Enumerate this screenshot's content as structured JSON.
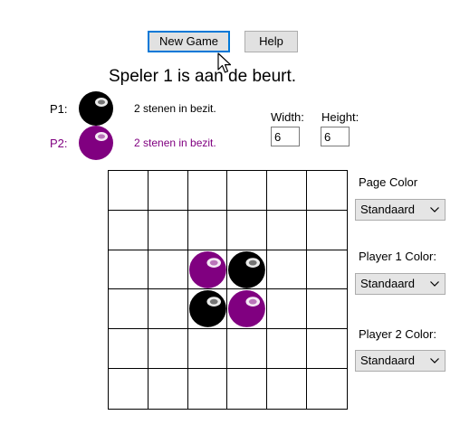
{
  "toolbar": {
    "new_game_label": "New Game",
    "help_label": "Help"
  },
  "status": {
    "turn_text": "Speler 1 is aan de beurt."
  },
  "players": [
    {
      "label": "P1:",
      "stones_text": "2 stenen in bezit.",
      "color": "#000000"
    },
    {
      "label": "P2:",
      "stones_text": "2 stenen in bezit.",
      "color": "#800080"
    }
  ],
  "board_size": {
    "width_label": "Width:",
    "height_label": "Height:",
    "width_value": "6",
    "height_value": "6"
  },
  "board": {
    "rows": 6,
    "cols": 6,
    "cells": [
      [
        "",
        "",
        "",
        "",
        "",
        ""
      ],
      [
        "",
        "",
        "",
        "",
        "",
        ""
      ],
      [
        "",
        "",
        "P2",
        "P1",
        "",
        ""
      ],
      [
        "",
        "",
        "P1",
        "P2",
        "",
        ""
      ],
      [
        "",
        "",
        "",
        "",
        "",
        ""
      ],
      [
        "",
        "",
        "",
        "",
        "",
        ""
      ]
    ]
  },
  "settings": {
    "page_color_label": "Page Color",
    "page_color_value": "Standaard",
    "player1_color_label": "Player 1 Color:",
    "player1_color_value": "Standaard",
    "player2_color_label": "Player 2 Color:",
    "player2_color_value": "Standaard"
  },
  "icons": {
    "cursor": "mouse-pointer-icon",
    "dropdown": "chevron-down-icon",
    "stone": "game-stone-icon"
  }
}
